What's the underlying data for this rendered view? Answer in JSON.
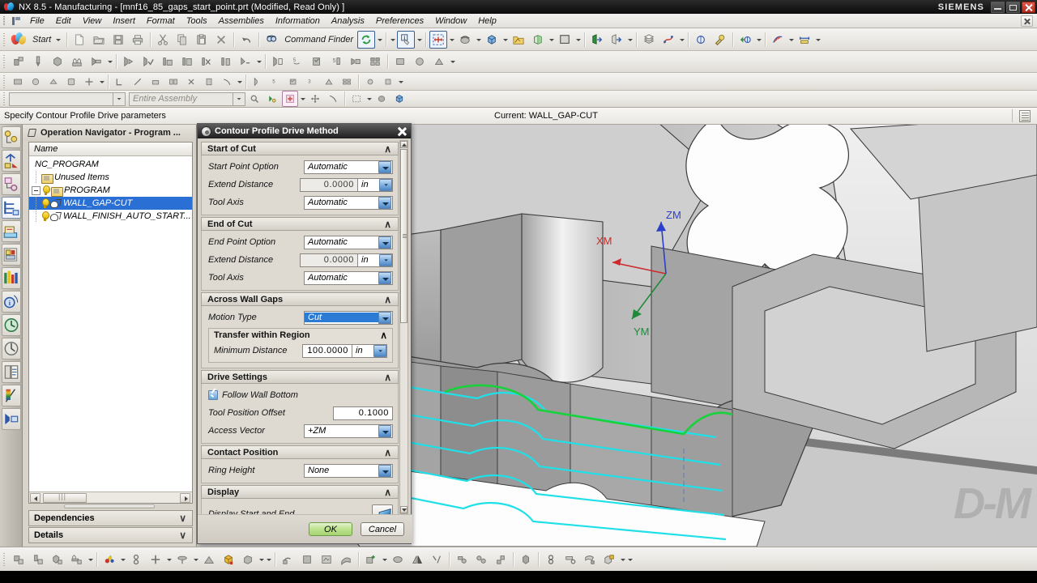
{
  "window": {
    "title": "NX 8.5 - Manufacturing - [mnf16_85_gaps_start_point.prt (Modified, Read Only) ]",
    "brand": "SIEMENS",
    "app_icon": "nx-logo-icon",
    "minimize": "minimize-icon",
    "maximize": "restore-icon",
    "close": "close-icon"
  },
  "menubar": {
    "items": [
      "File",
      "Edit",
      "View",
      "Insert",
      "Format",
      "Tools",
      "Assemblies",
      "Information",
      "Analysis",
      "Preferences",
      "Window",
      "Help"
    ]
  },
  "toolbar_row1": {
    "start_label": "Start",
    "command_finder_label": "Command Finder",
    "icons": [
      "new-document-icon",
      "open-folder-icon",
      "save-icon",
      "print-icon",
      "cut-icon",
      "copy-icon",
      "paste-icon",
      "delete-icon",
      "undo-icon",
      "command-finder-icon",
      "refresh-icon"
    ]
  },
  "toolbar_row2": {
    "icons": [
      "info-object-icon",
      "fit-view-icon",
      "rotate-view-icon",
      "shaded-box-icon",
      "layer-folder-icon",
      "section-view-icon",
      "background-icon",
      "show-object-icon",
      "hide-object-icon",
      "layer-stack-icon",
      "curve-icon",
      "measure-distance-icon",
      "analysis-key-icon",
      "vector-icon",
      "spline-icon",
      "dimension-icon"
    ]
  },
  "toolbar_row3": {
    "icons": [
      "create-program-icon",
      "create-tool-icon",
      "create-geometry-icon",
      "create-method-icon",
      "create-operation-icon",
      "generate-toolpath-icon",
      "verify-toolpath-icon",
      "replay-icon",
      "list-toolpath-icon",
      "delete-toolpath-icon",
      "confirm-toolpath-icon",
      "transform-icon",
      "machine-icon",
      "post-process-icon",
      "shop-doc-icon",
      "workpiece-icon",
      "simulate-icon",
      "output-cls-icon"
    ]
  },
  "toolbar_row4": {
    "assembly_filter_value": "",
    "assembly_scope_placeholder": "Entire Assembly",
    "icons": [
      "find-object-icon",
      "snap-point-icon",
      "selection-filter-icon",
      "move-object-icon",
      "trace-icon",
      "rectangle-select-icon",
      "shaded-mode-icon",
      "solid-body-icon"
    ]
  },
  "cue_line": {
    "prompt": "Specify Contour Profile Drive parameters",
    "current": "Current: WALL_GAP-CUT",
    "indicator_icon": "list-indicator-icon"
  },
  "resource_bar": {
    "items": [
      {
        "name": "assembly-navigator-icon"
      },
      {
        "name": "constraint-navigator-icon"
      },
      {
        "name": "part-navigator-icon"
      },
      {
        "name": "operation-navigator-icon",
        "active": true
      },
      {
        "name": "machine-tool-navigator-icon"
      },
      {
        "name": "reuse-library-icon"
      },
      {
        "name": "hd3d-tools-icon"
      },
      {
        "name": "web-browser-icon"
      },
      {
        "name": "history-icon"
      },
      {
        "name": "process-studio-icon"
      },
      {
        "name": "roles-icon"
      },
      {
        "name": "system-materials-icon"
      },
      {
        "name": "dock-toggle-icon"
      }
    ]
  },
  "operation_navigator": {
    "title": "Operation Navigator - Program ...",
    "column_header": "Name",
    "rows": [
      {
        "label": "NC_PROGRAM",
        "depth": 0,
        "icon": "none",
        "selected": false,
        "expander": false,
        "bulb": false
      },
      {
        "label": "Unused Items",
        "depth": 1,
        "icon": "folder",
        "selected": false,
        "expander": false,
        "bulb": false
      },
      {
        "label": "PROGRAM",
        "depth": 1,
        "icon": "folder",
        "selected": false,
        "expander": true,
        "bulb": true
      },
      {
        "label": "WALL_GAP-CUT",
        "depth": 2,
        "icon": "operation",
        "selected": true,
        "expander": false,
        "bulb": true
      },
      {
        "label": "WALL_FINISH_AUTO_START...",
        "depth": 2,
        "icon": "operation",
        "selected": false,
        "expander": false,
        "bulb": true
      }
    ],
    "scroll_left_icon": "scroll-left-icon",
    "scroll_right_icon": "scroll-right-icon",
    "panels": [
      {
        "label": "Dependencies",
        "chevron": "∨"
      },
      {
        "label": "Details",
        "chevron": "∨"
      }
    ]
  },
  "viewport": {
    "watermark": "D-M",
    "axes": [
      {
        "label": "XM",
        "color": "#cc2b2b"
      },
      {
        "label": "ZM",
        "color": "#2b3fcc"
      },
      {
        "label": "YM",
        "color": "#1f8a3a"
      }
    ],
    "toolpath_color": "#1fe0e8",
    "highlight_color": "#17d23a"
  },
  "dialog": {
    "title": "Contour Profile Drive Method",
    "gear_icon": "options-gear-icon",
    "close_icon": "dialog-close-icon",
    "chevron_up": "∧",
    "groups": [
      {
        "title": "Start of Cut",
        "rows": [
          {
            "label": "Start Point Option",
            "type": "combo",
            "value": "Automatic"
          },
          {
            "label": "Extend Distance",
            "type": "number_unit",
            "value": "0.0000",
            "unit": "in"
          },
          {
            "label": "Tool Axis",
            "type": "combo",
            "value": "Automatic"
          }
        ]
      },
      {
        "title": "End of Cut",
        "rows": [
          {
            "label": "End Point Option",
            "type": "combo",
            "value": "Automatic"
          },
          {
            "label": "Extend Distance",
            "type": "number_unit",
            "value": "0.0000",
            "unit": "in"
          },
          {
            "label": "Tool Axis",
            "type": "combo",
            "value": "Automatic"
          }
        ]
      }
    ],
    "across_wall_gaps": {
      "title": "Across Wall Gaps",
      "motion_type_label": "Motion Type",
      "motion_type_value": "Cut",
      "transfer_title": "Transfer within Region",
      "minimum_distance_label": "Minimum Distance",
      "minimum_distance_value": "100.0000",
      "minimum_distance_unit": "in"
    },
    "drive_settings": {
      "title": "Drive Settings",
      "follow_wall_bottom_label": "Follow Wall Bottom",
      "follow_wall_bottom_checked": true,
      "tool_position_offset_label": "Tool Position Offset",
      "tool_position_offset_value": "0.1000",
      "access_vector_label": "Access Vector",
      "access_vector_value": "+ZM"
    },
    "contact_position": {
      "title": "Contact Position",
      "ring_height_label": "Ring Height",
      "ring_height_value": "None"
    },
    "display": {
      "title": "Display",
      "display_start_end_label": "Display Start and End",
      "button_icon": "display-start-end-icon"
    },
    "ok_label": "OK",
    "cancel_label": "Cancel"
  },
  "bottom_toolbar": {
    "icons": [
      "create-program-group-icon",
      "create-tool-group-icon",
      "create-geometry-group-icon",
      "create-method-group-icon",
      "color-display-icon",
      "link-icon",
      "add-point-icon",
      "plane-icon",
      "machine-base-icon",
      "workpiece-cube-icon",
      "blank-icon",
      "boundary-icon",
      "solid-shape-icon",
      "region-icon",
      "surface-icon",
      "add-geometry-icon",
      "copy-geometry-icon",
      "mirror-icon",
      "trim-icon",
      "tool-shank-icon",
      "holder-icon",
      "turret-icon",
      "faceted-body-icon",
      "chain-icon",
      "measure-icon",
      "analyze-icon",
      "box-block-icon"
    ]
  }
}
